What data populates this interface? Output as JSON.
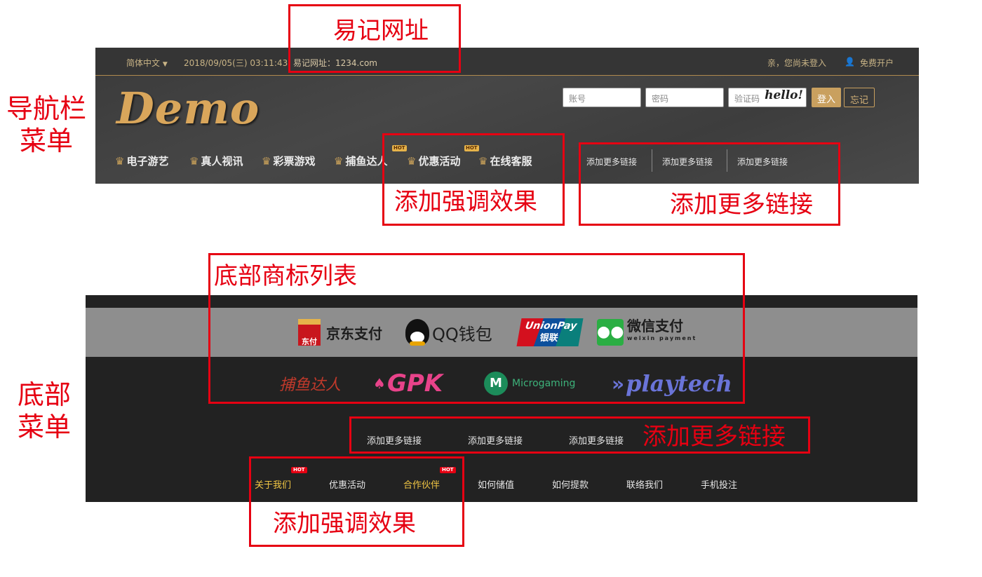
{
  "annotations": {
    "easy_url": "易记网址",
    "nav_menu": "导航栏菜单",
    "emphasis_top": "添加强调效果",
    "more_links_top": "添加更多链接",
    "footer_logos": "底部商标列表",
    "footer_menu": "底部菜单",
    "more_links_footer": "添加更多链接",
    "emphasis_footer": "添加强调效果"
  },
  "topbar": {
    "language": "简体中文",
    "datetime": "2018/09/05(三) 03:11:43",
    "easy_url": "易记网址：1234.com",
    "login_status": "亲，您尚未登入",
    "register": "免费开户"
  },
  "logo": "Demo",
  "login": {
    "account_placeholder": "账号",
    "password_placeholder": "密码",
    "captcha_placeholder": "验证码",
    "captcha_image": "hello!",
    "login_button": "登入",
    "forgot_button": "忘记"
  },
  "nav": {
    "items": [
      {
        "label": "电子游艺"
      },
      {
        "label": "真人视讯"
      },
      {
        "label": "彩票游戏"
      },
      {
        "label": "捕鱼达人"
      },
      {
        "label": "优惠活动",
        "badge": "HOT"
      },
      {
        "label": "在线客服",
        "badge": "HOT"
      }
    ],
    "more_links": [
      "添加更多链接",
      "添加更多链接",
      "添加更多链接"
    ]
  },
  "footer": {
    "payments": [
      {
        "label": "京东支付",
        "icon_text": "东付"
      },
      {
        "label": "QQ钱包"
      },
      {
        "label": "UnionPay",
        "sub": "银联"
      },
      {
        "label": "微信支付",
        "sub": "weixin payment"
      }
    ],
    "games": [
      {
        "label": "捕鱼达人"
      },
      {
        "label": "GPK"
      },
      {
        "label": "Microgaming"
      },
      {
        "label": "playtech"
      }
    ],
    "more_links": [
      "添加更多链接",
      "添加更多链接",
      "添加更多链接"
    ],
    "menu": [
      {
        "label": "关于我们",
        "badge": "HOT",
        "highlight": true
      },
      {
        "label": "优惠活动"
      },
      {
        "label": "合作伙伴",
        "badge": "HOT",
        "highlight": true
      },
      {
        "label": "如何储值"
      },
      {
        "label": "如何提款"
      },
      {
        "label": "联络我们"
      },
      {
        "label": "手机投注"
      }
    ]
  },
  "colors": {
    "annotation_red": "#e60012",
    "gold": "#d9a65b",
    "highlight_yellow": "#f2c744",
    "login_button": "#c9a05f"
  }
}
